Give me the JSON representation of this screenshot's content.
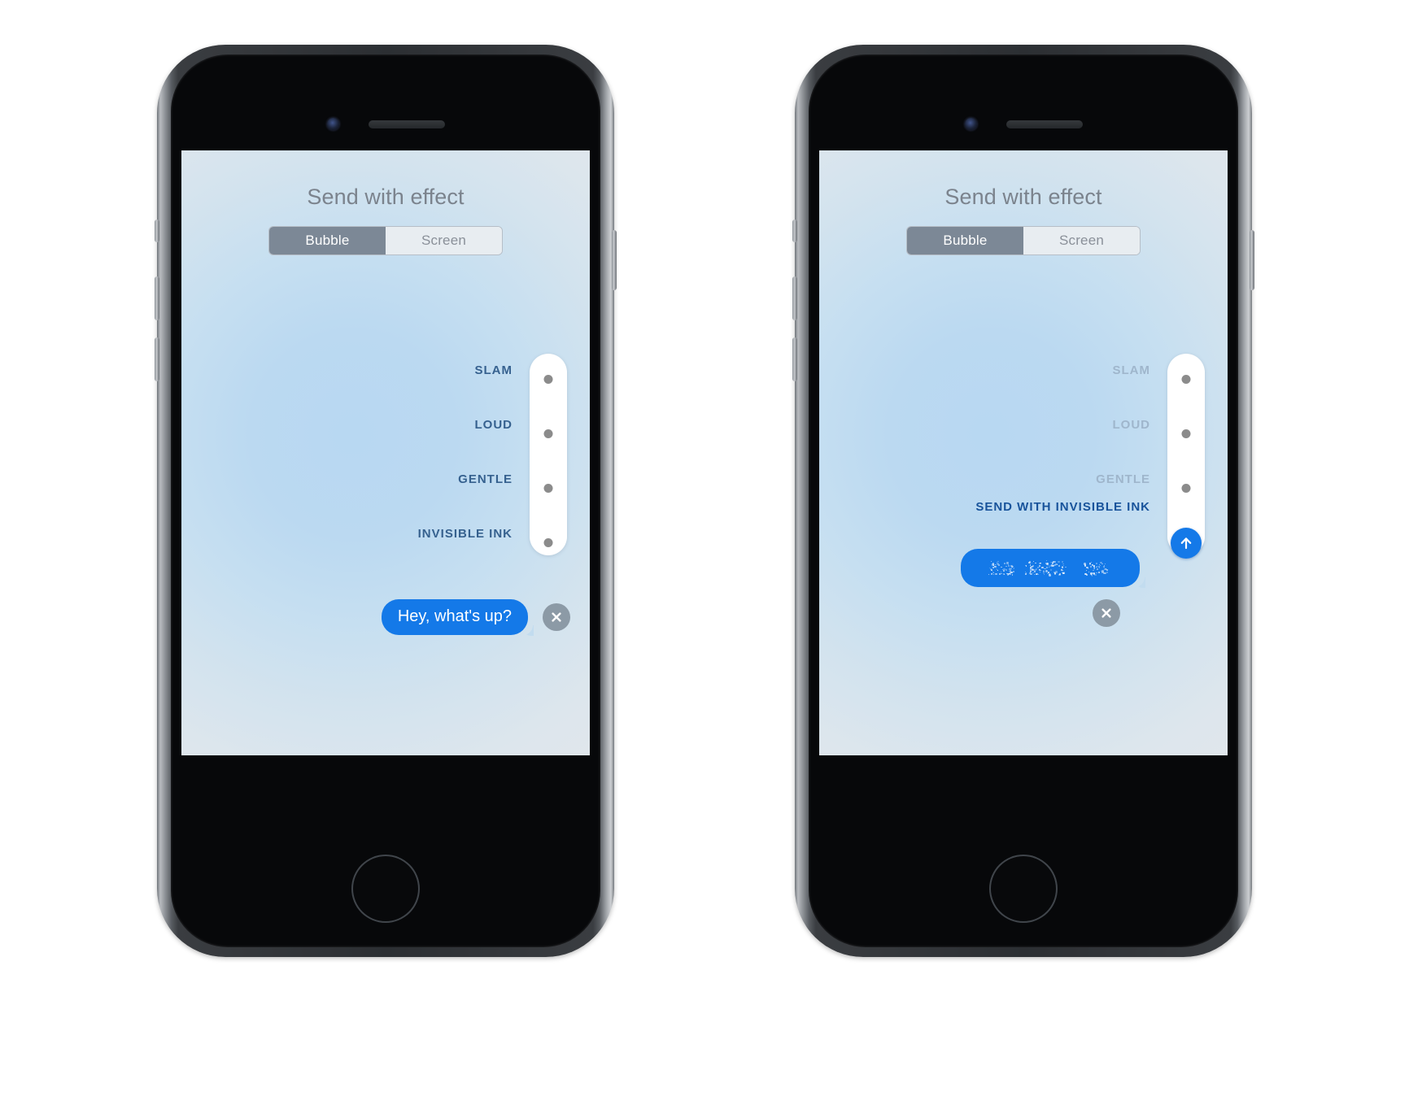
{
  "page": {
    "background": "#ffffff",
    "device_count": 2
  },
  "colors": {
    "accent_blue": "#1479e8",
    "segment_selected_bg": "#7c8896",
    "title_gray": "#7b838d",
    "label_blue": "#36618f",
    "label_dim": "#9fb6cc",
    "label_active": "#18539b",
    "close_gray": "#8c9aa6",
    "dot_gray": "#8b8b8b"
  },
  "phones": [
    {
      "id": "phone-left",
      "hardware": {
        "camera_icon": "camera-dot-icon",
        "earpiece_icon": "earpiece-speaker-icon",
        "home_button_label": "home-button"
      },
      "screen": {
        "title": "Send with effect",
        "segmented_control": {
          "options": [
            {
              "label": "Bubble",
              "selected": true
            },
            {
              "label": "Screen",
              "selected": false
            }
          ]
        },
        "effects": [
          {
            "label": "SLAM",
            "state": "normal"
          },
          {
            "label": "LOUD",
            "state": "normal"
          },
          {
            "label": "GENTLE",
            "state": "normal"
          },
          {
            "label": "INVISIBLE INK",
            "state": "normal"
          }
        ],
        "selector_dots": 4,
        "send_button_visible": false,
        "message": {
          "text": "Hey, what's up?",
          "obscured": false
        },
        "close_button_icon": "close-x-icon"
      }
    },
    {
      "id": "phone-right",
      "hardware": {
        "camera_icon": "camera-dot-icon",
        "earpiece_icon": "earpiece-speaker-icon",
        "home_button_label": "home-button"
      },
      "screen": {
        "title": "Send with effect",
        "segmented_control": {
          "options": [
            {
              "label": "Bubble",
              "selected": true
            },
            {
              "label": "Screen",
              "selected": false
            }
          ]
        },
        "effects": [
          {
            "label": "SLAM",
            "state": "dim"
          },
          {
            "label": "LOUD",
            "state": "dim"
          },
          {
            "label": "GENTLE",
            "state": "dim"
          },
          {
            "label": "SEND WITH INVISIBLE INK",
            "state": "active"
          }
        ],
        "selector_dots": 3,
        "send_button_visible": true,
        "send_button_icon": "send-arrow-up-icon",
        "message": {
          "text": "",
          "obscured": true,
          "obscured_description": "scrambled invisible ink particles"
        },
        "close_button_icon": "close-x-icon"
      }
    }
  ]
}
